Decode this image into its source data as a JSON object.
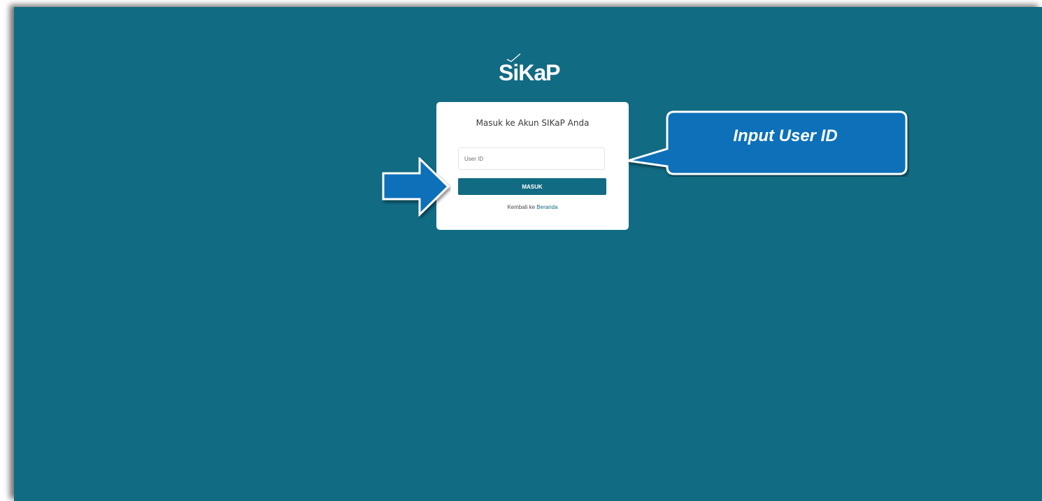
{
  "logo": {
    "text": "SiKaP"
  },
  "login_card": {
    "title": "Masuk ke Akun SIKaP Anda",
    "user_id_placeholder": "User ID",
    "user_id_value": "",
    "submit_label": "MASUK",
    "back_prefix": "Kembali ke",
    "back_link_label": "Beranda"
  },
  "annotation": {
    "callout_text": "Input User ID"
  },
  "colors": {
    "background": "#116b83",
    "accent": "#116b83",
    "callout": "#0c6fb9",
    "card": "#ffffff"
  }
}
